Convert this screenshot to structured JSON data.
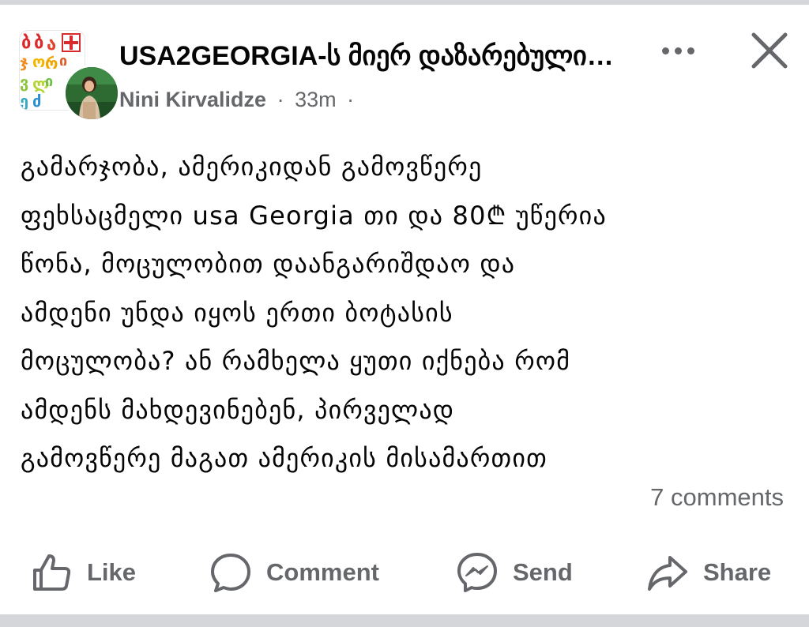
{
  "post": {
    "group_name": "USA2GEORGIA-ს მიერ დაზარებული…",
    "author": "Nini Kirvalidze",
    "separator": "·",
    "time": "33m",
    "trailing_separator": "·",
    "body": "გამარჯობა, ამერიკიდან გამოვწერე\nფეხსაცმელი usa Georgia თი და 80₾ უწერია\nწონა, მოცულობით დაანგარიშდაო და\nამდენი უნდა იყოს ერთი ბოტასის\nმოცულობა? ან რამხელა ყუთი იქნება რომ\nამდენს მახდევინებენ, პირველად\nგამოვწერე მაგათ ამერიკის მისამართით",
    "comments_count": "7 comments"
  },
  "actions": {
    "like": "Like",
    "comment": "Comment",
    "send": "Send",
    "share": "Share"
  },
  "icons": {
    "more": "more-horizontal-icon",
    "close": "close-icon",
    "like": "thumbs-up-icon",
    "comment": "comment-bubble-icon",
    "send": "messenger-icon",
    "share": "share-arrow-icon"
  },
  "colors": {
    "text_primary": "#050505",
    "text_secondary": "#65676b",
    "divider": "#d4d6da"
  }
}
